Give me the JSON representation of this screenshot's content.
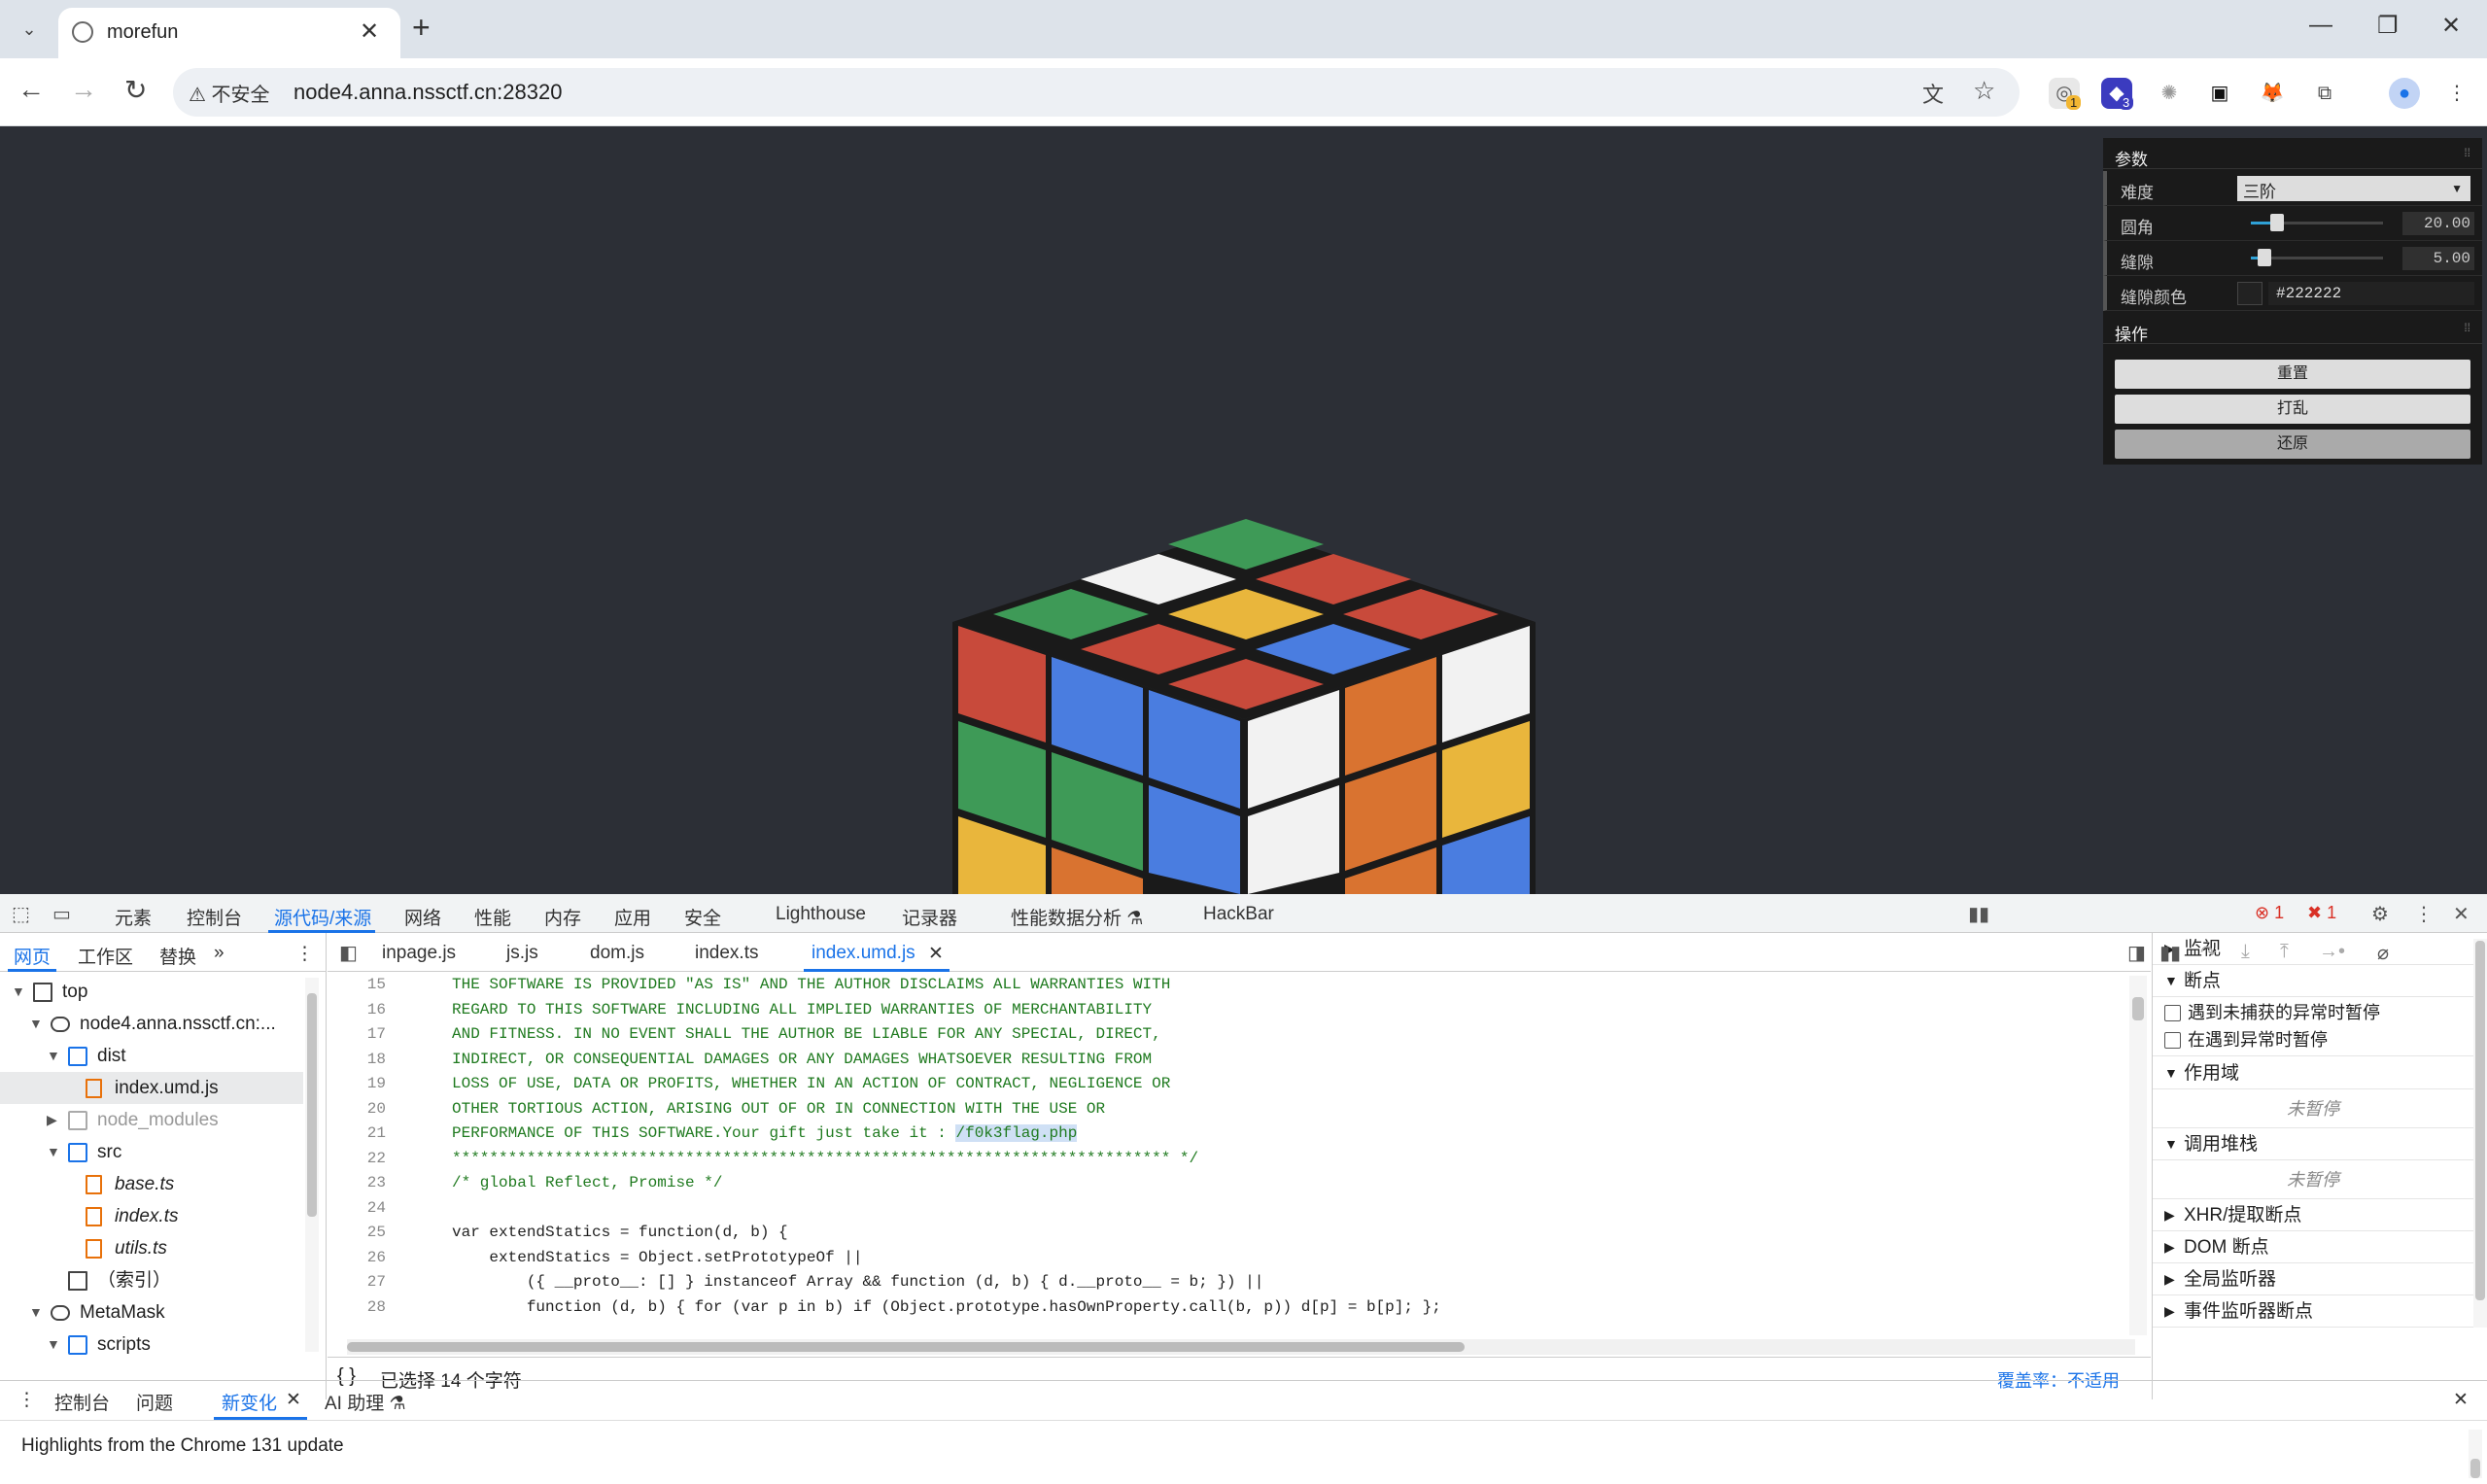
{
  "browser": {
    "tab_title": "morefun",
    "new_tab": "+",
    "minimize": "—",
    "maximize": "❐",
    "close": "✕",
    "security_label": "不安全",
    "url": "node4.anna.nssctf.cn:28320",
    "ext_badges": [
      "1",
      "3"
    ]
  },
  "gui": {
    "params_title": "参数",
    "collapse": "⁞⁞",
    "difficulty_label": "难度",
    "difficulty_value": "三阶",
    "corner_label": "圆角",
    "corner_value": "20.00",
    "corner_level": 0.2,
    "gap_label": "缝隙",
    "gap_value": "5.00",
    "gap_level": 0.1,
    "gap_color_label": "缝隙颜色",
    "gap_color_value": "#222222",
    "ops_title": "操作",
    "reset": "重置",
    "scramble": "打乱",
    "restore": "还原"
  },
  "devtools": {
    "tabs": [
      "元素",
      "控制台",
      "源代码/来源",
      "网络",
      "性能",
      "内存",
      "应用",
      "安全",
      "Lighthouse",
      "记录器",
      "性能数据分析 ⚗",
      "HackBar"
    ],
    "active_tab": "源代码/来源",
    "errors": "1",
    "warnings": "1",
    "nav_tabs": [
      "网页",
      "工作区",
      "替换",
      "»"
    ],
    "tree": [
      {
        "name": "top",
        "depth": 0,
        "arrow": "▼",
        "icon": "frame"
      },
      {
        "name": "node4.anna.nssctf.cn:...",
        "depth": 1,
        "arrow": "▼",
        "icon": "cloud"
      },
      {
        "name": "dist",
        "depth": 2,
        "arrow": "▼",
        "icon": "folder"
      },
      {
        "name": "index.umd.js",
        "depth": 3,
        "arrow": "",
        "icon": "file",
        "selected": true
      },
      {
        "name": "node_modules",
        "depth": 2,
        "arrow": "▶",
        "icon": "folder-gray",
        "dim": true
      },
      {
        "name": "src",
        "depth": 2,
        "arrow": "▼",
        "icon": "folder"
      },
      {
        "name": "base.ts",
        "depth": 3,
        "arrow": "",
        "icon": "file",
        "italic": true
      },
      {
        "name": "index.ts",
        "depth": 3,
        "arrow": "",
        "icon": "file",
        "italic": true
      },
      {
        "name": "utils.ts",
        "depth": 3,
        "arrow": "",
        "icon": "file",
        "italic": true
      },
      {
        "name": "（索引）",
        "depth": 2,
        "arrow": "",
        "icon": "doc"
      },
      {
        "name": "MetaMask",
        "depth": 1,
        "arrow": "▼",
        "icon": "cloud"
      },
      {
        "name": "scripts",
        "depth": 2,
        "arrow": "▼",
        "icon": "folder"
      }
    ],
    "editor_tabs": [
      "inpage.js",
      "js.js",
      "dom.js",
      "index.ts",
      "index.umd.js"
    ],
    "active_editor_tab": "index.umd.js",
    "code_lines": [
      {
        "n": "15",
        "t": "THE SOFTWARE IS PROVIDED \"AS IS\" AND THE AUTHOR DISCLAIMS ALL WARRANTIES WITH"
      },
      {
        "n": "16",
        "t": "REGARD TO THIS SOFTWARE INCLUDING ALL IMPLIED WARRANTIES OF MERCHANTABILITY"
      },
      {
        "n": "17",
        "t": "AND FITNESS. IN NO EVENT SHALL THE AUTHOR BE LIABLE FOR ANY SPECIAL, DIRECT,"
      },
      {
        "n": "18",
        "t": "INDIRECT, OR CONSEQUENTIAL DAMAGES OR ANY DAMAGES WHATSOEVER RESULTING FROM"
      },
      {
        "n": "19",
        "t": "LOSS OF USE, DATA OR PROFITS, WHETHER IN AN ACTION OF CONTRACT, NEGLIGENCE OR"
      },
      {
        "n": "20",
        "t": "OTHER TORTIOUS ACTION, ARISING OUT OF OR IN CONNECTION WITH THE USE OR"
      },
      {
        "n": "21",
        "t": "PERFORMANCE OF THIS SOFTWARE.Your gift just take it : ",
        "hl": "/f0k3flag.php"
      },
      {
        "n": "22",
        "t": "***************************************************************************** */"
      },
      {
        "n": "23",
        "t": "/* global Reflect, Promise */"
      },
      {
        "n": "24",
        "t": ""
      },
      {
        "n": "25",
        "t": "var extendStatics = function(d, b) {"
      },
      {
        "n": "26",
        "t": "    extendStatics = Object.setPrototypeOf ||"
      },
      {
        "n": "27",
        "t": "        ({ __proto__: [] } instanceof Array && function (d, b) { d.__proto__ = b; }) ||"
      },
      {
        "n": "28",
        "t": "        function (d, b) { for (var p in b) if (Object.prototype.hasOwnProperty.call(b, p)) d[p] = b[p]; };"
      }
    ],
    "selection_status": "已选择 14 个字符",
    "coverage": "覆盖率：不适用",
    "side": {
      "watch": "监视",
      "breakpoints": "断点",
      "pause_uncaught": "遇到未捕获的异常时暂停",
      "pause_caught": "在遇到异常时暂停",
      "scope": "作用域",
      "not_paused": "未暂停",
      "callstack": "调用堆栈",
      "xhr": "XHR/提取断点",
      "dom": "DOM 断点",
      "global": "全局监听器",
      "event": "事件监听器断点"
    },
    "drawer": {
      "tabs": [
        "控制台",
        "问题",
        "新变化",
        "AI 助理 ⚗"
      ],
      "active": "新变化",
      "highlights": "Highlights from the Chrome 131 update"
    }
  },
  "colors": {
    "accent": "#1a73e8",
    "cube_green": "#3e9a57",
    "cube_red": "#c84a3b",
    "cube_blue": "#4a7de0",
    "cube_yellow": "#e9b63c",
    "cube_orange": "#d97330",
    "cube_white": "#f2f2f2"
  }
}
